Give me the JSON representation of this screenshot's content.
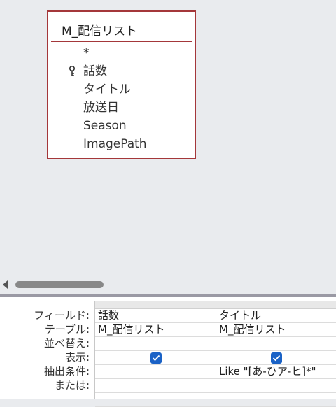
{
  "table": {
    "title": "M_配信リスト",
    "fields": [
      "*",
      "話数",
      "タイトル",
      "放送日",
      "Season",
      "ImagePath"
    ]
  },
  "grid": {
    "row_labels": [
      "フィールド:",
      "テーブル:",
      "並べ替え:",
      "表示:",
      "抽出条件:",
      "または:"
    ],
    "columns": [
      {
        "field": "話数",
        "table": "M_配信リスト",
        "sort": "",
        "show": true,
        "criteria": "",
        "or": ""
      },
      {
        "field": "タイトル",
        "table": "M_配信リスト",
        "sort": "",
        "show": true,
        "criteria": "Like \"[あ-ひア-ヒ]*\"",
        "or": ""
      }
    ]
  },
  "colors": {
    "table_border": "#a4373a",
    "checkbox": "#1a62c6",
    "splitter": "#9a99a4"
  },
  "icons": {
    "primary_key": "key-icon",
    "scroll_left": "scroll-left-arrow-icon"
  }
}
